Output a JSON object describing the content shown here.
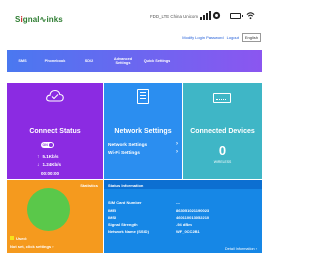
{
  "header": {
    "logo_prefix": "S",
    "logo_ink": "i",
    "logo_mid": "gnal",
    "logo_suffix": "inks",
    "network": "FDD_LTE  China Unicom",
    "modify_password": "Modify Login Password",
    "logout": "Logout",
    "language": "English"
  },
  "menu": {
    "items": [
      {
        "label": "SMS"
      },
      {
        "label": "Phonebook"
      },
      {
        "label": "SD/2"
      },
      {
        "label": "Advanced Settings"
      },
      {
        "label": "Quick Settings"
      }
    ]
  },
  "connect_status": {
    "title": "Connect Status",
    "toggle_label": "ON",
    "upload_rate": "5.1Kb/s",
    "download_rate": "1.24Kb/s",
    "duration": "00:00:00"
  },
  "network_settings": {
    "title": "Network Settings",
    "link1": "Network Settings",
    "link2": "Wi-Fi Settings"
  },
  "connected_devices": {
    "title": "Connected Devices",
    "count": "0",
    "sub": "WIRELESS"
  },
  "statistics": {
    "title": "Statistics",
    "used_label": "Used:",
    "link": "Not set, click settings"
  },
  "status_info": {
    "title": "Status Information",
    "rows": [
      {
        "label": "SIM Card Number",
        "value": "---"
      },
      {
        "label": "IMEI",
        "value": "863051021190023"
      },
      {
        "label": "IMSI",
        "value": "460110013052210"
      },
      {
        "label": "Signal Strength",
        "value": "-94 dBm"
      },
      {
        "label": "Network Name (SSID)",
        "value": "WF_0CC2B1"
      }
    ],
    "detail_link": "Detail Information"
  },
  "colors": {
    "menu_start": "#4a78f0",
    "menu_end": "#8b56f0",
    "connect_status": "#8b2be2",
    "network_settings": "#2b8ef0",
    "connected_devices": "#3fb6c6",
    "statistics": "#f59a1e",
    "status_info": "#1687e6",
    "pie_free": "#5ac84a",
    "legend_used": "#f7e21b"
  }
}
